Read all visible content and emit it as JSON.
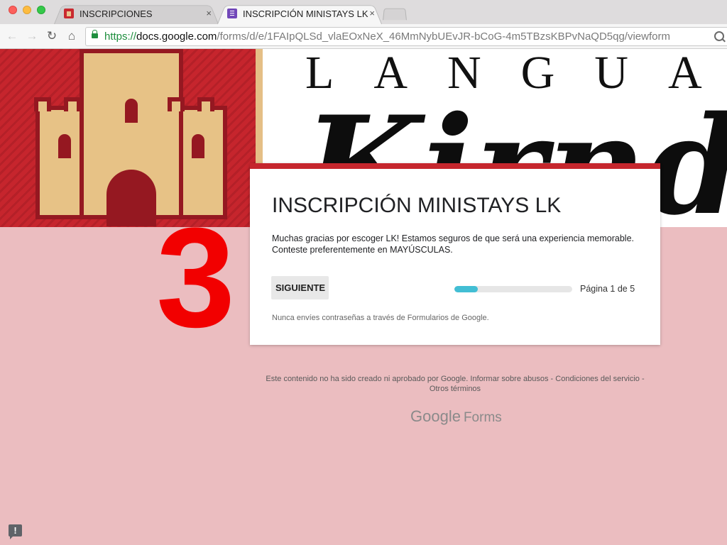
{
  "browser": {
    "tabs": [
      {
        "title": "INSCRIPCIONES",
        "favicon": "castle-favicon",
        "active": false
      },
      {
        "title": "INSCRIPCIÓN MINISTAYS LK",
        "favicon": "google-forms-favicon",
        "active": true
      }
    ],
    "close_glyph": "×",
    "url": {
      "scheme": "https://",
      "host": "docs.google.com",
      "path": "/forms/d/e/1FAIpQLSd_vlaEOxNeX_46MmNybUEvJR-bCoG-4m5TBzsKBPvNaQD5qg/viewform"
    }
  },
  "banner": {
    "heading_letters": "LANGUA",
    "script_letters": "Kirnd"
  },
  "overlay": {
    "number": "3",
    "color": "#f20000"
  },
  "form": {
    "title": "INSCRIPCIÓN MINISTAYS LK",
    "description_line1": "Muchas gracias por escoger LK! Estamos seguros de que será una experiencia memorable.",
    "description_line2": "Conteste preferentemente en MAYÚSCULAS.",
    "next_label": "SIGUIENTE",
    "progress": {
      "current": 1,
      "total": 5,
      "fraction": 0.2
    },
    "page_indicator": "Página 1 de 5",
    "password_note": "Nunca envíes contraseñas a través de Formularios de Google.",
    "accent_color": "#c5262d",
    "progress_color": "#42bed4"
  },
  "footer": {
    "disclaimer": "Este contenido no ha sido creado ni aprobado por Google.",
    "report_link": "Informar sobre abusos",
    "separator": " - ",
    "terms_link": "Condiciones del servicio",
    "other_terms_link": "Otros términos",
    "brand_google": "Google",
    "brand_forms": "Forms"
  },
  "report_icon_glyph": "!",
  "background_color": "#ebbdc0"
}
